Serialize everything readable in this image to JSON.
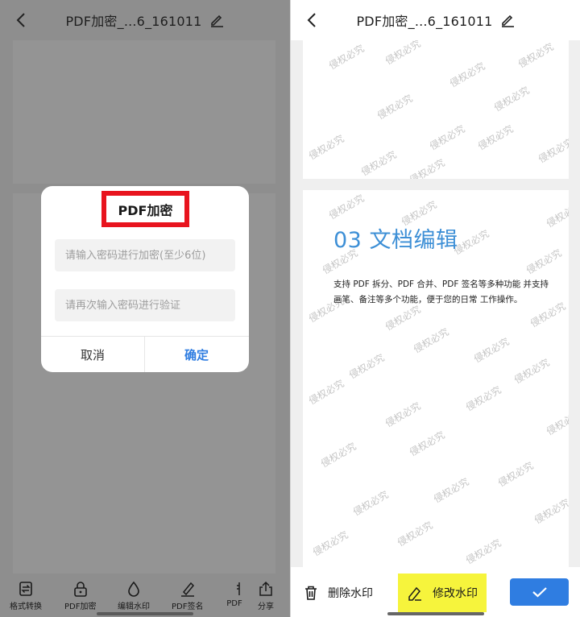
{
  "left": {
    "header": {
      "title": "PDF加密_...6_161011"
    },
    "dialog": {
      "title": "PDF加密",
      "password_placeholder": "请输入密码进行加密(至少6位)",
      "confirm_placeholder": "请再次输入密码进行验证",
      "cancel_label": "取消",
      "confirm_label": "确定"
    },
    "toolbar": {
      "items": [
        {
          "label": "格式转换",
          "icon": "format-convert-icon"
        },
        {
          "label": "PDF加密",
          "icon": "lock-icon"
        },
        {
          "label": "编辑水印",
          "icon": "droplet-icon"
        },
        {
          "label": "PDF签名",
          "icon": "signature-pen-icon"
        },
        {
          "label": "PDF",
          "icon": "document-icon"
        },
        {
          "label": "分享",
          "icon": "share-icon"
        }
      ]
    }
  },
  "right": {
    "header": {
      "title": "PDF加密_...6_161011"
    },
    "watermark_text": "侵权必究",
    "page2": {
      "heading": "03 文档编辑",
      "paragraph": "支持 PDF 拆分、PDF 合并、PDF 签名等多种功能 并支持画笔、备注等多个功能，便于您的日常 工作操作。"
    },
    "toolbar": {
      "delete_label": "删除水印",
      "modify_label": "修改水印"
    }
  },
  "colors": {
    "accent_blue": "#2f7de1",
    "heading_blue": "#3d8fd6",
    "highlight_red": "#e8141e",
    "highlight_yellow": "#f6f43c",
    "overlay_gray": "#8e8e8e"
  }
}
